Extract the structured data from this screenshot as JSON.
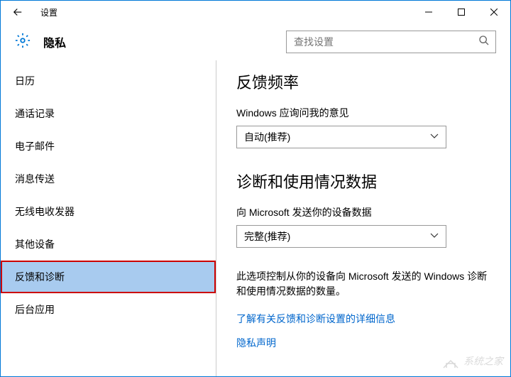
{
  "app_title": "设置",
  "page_title": "隐私",
  "search": {
    "placeholder": "查找设置"
  },
  "sidebar": {
    "items": [
      {
        "label": "日历"
      },
      {
        "label": "通话记录"
      },
      {
        "label": "电子邮件"
      },
      {
        "label": "消息传送"
      },
      {
        "label": "无线电收发器"
      },
      {
        "label": "其他设备"
      },
      {
        "label": "反馈和诊断"
      },
      {
        "label": "后台应用"
      }
    ],
    "selected_index": 6
  },
  "main": {
    "section1": {
      "title": "反馈频率",
      "label": "Windows 应询问我的意见",
      "dropdown_value": "自动(推荐)"
    },
    "section2": {
      "title": "诊断和使用情况数据",
      "label": "向 Microsoft 发送你的设备数据",
      "dropdown_value": "完整(推荐)",
      "description": "此选项控制从你的设备向 Microsoft 发送的 Windows 诊断和使用情况数据的数量。",
      "link1": "了解有关反馈和诊断设置的详细信息",
      "link2": "隐私声明"
    }
  },
  "watermark": "系统之家"
}
